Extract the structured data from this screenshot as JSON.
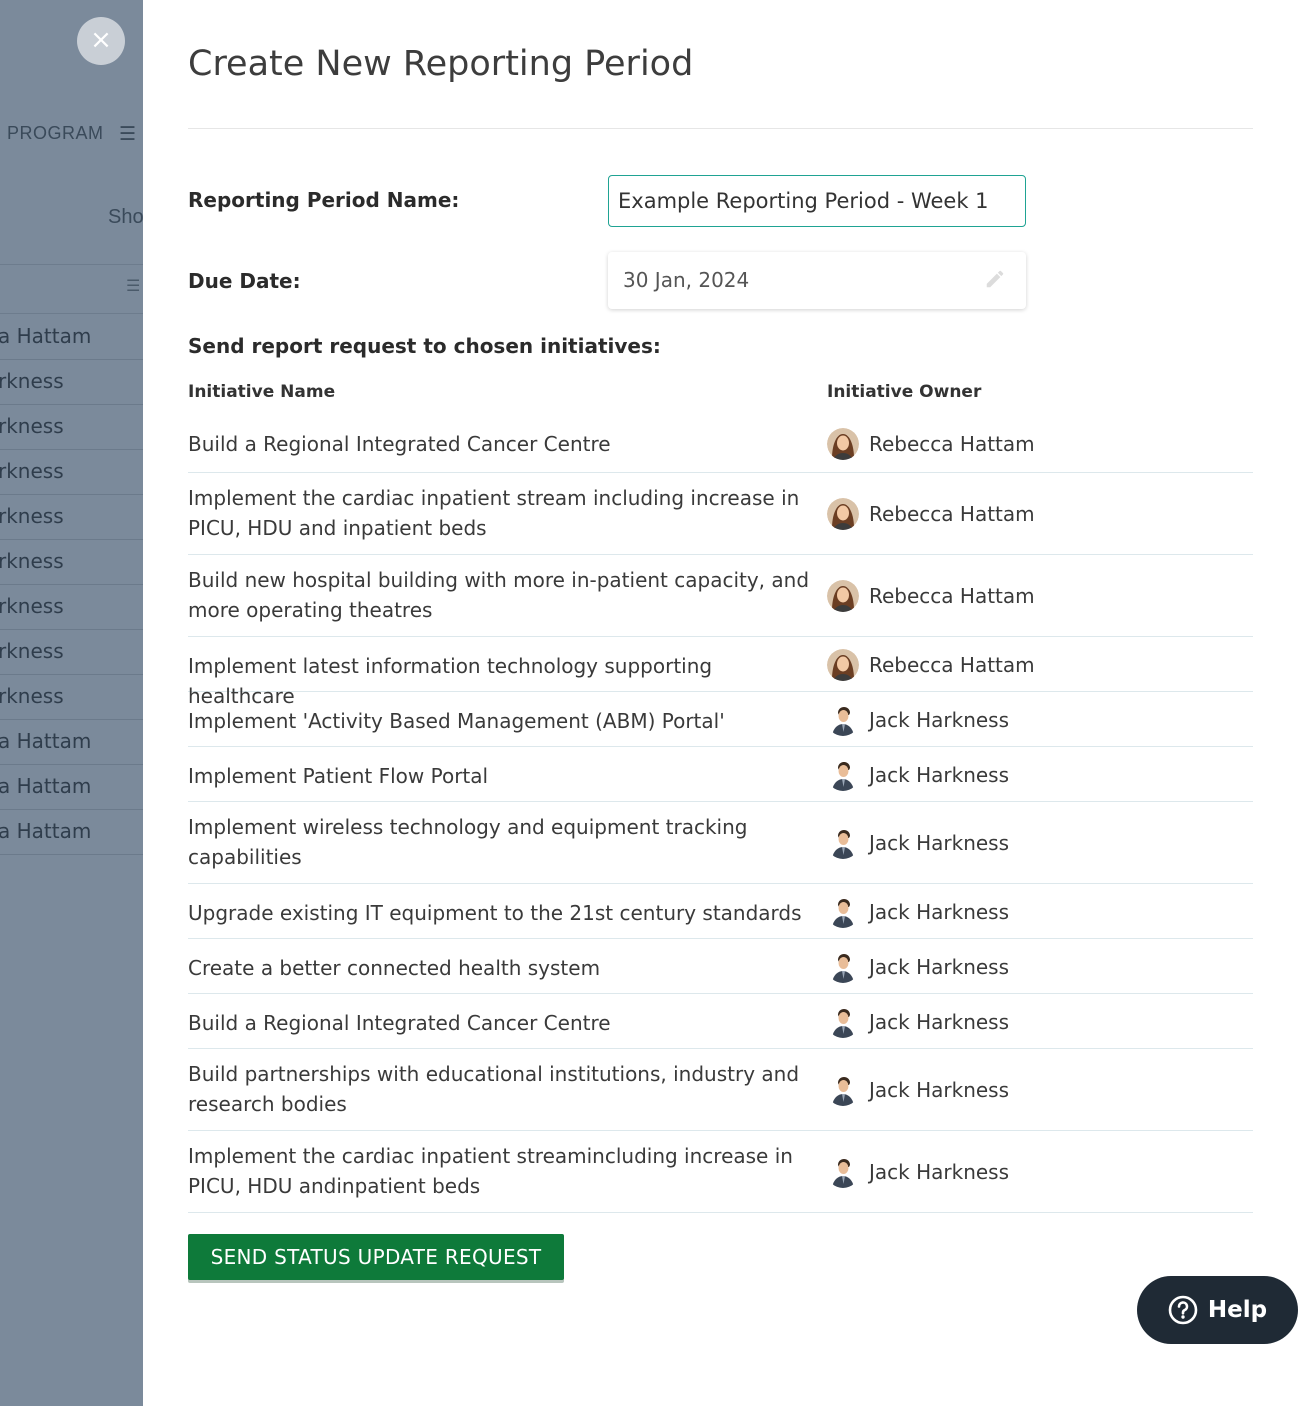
{
  "background": {
    "program_label": "PROGRAM",
    "menu_icon": "☰",
    "partial_text": "Sho",
    "list_icon": "☰",
    "rows": [
      "a Hattam",
      "rkness",
      "rkness",
      "rkness",
      "rkness",
      "rkness",
      "rkness",
      "rkness",
      "rkness",
      "a Hattam",
      "a Hattam",
      "a Hattam"
    ]
  },
  "close_icon": "×",
  "modal": {
    "title": "Create New Reporting Period",
    "name_label": "Reporting Period Name:",
    "name_value": "Example Reporting Period - Week 1",
    "due_label": "Due Date:",
    "due_value": "30 Jan, 2024",
    "send_label": "Send report request to chosen initiatives:",
    "col_name": "Initiative Name",
    "col_owner": "Initiative Owner",
    "initiatives": [
      {
        "name": "Build a Regional Integrated Cancer Centre",
        "owner": "Rebecca Hattam",
        "avatar": "female"
      },
      {
        "name": "Implement the cardiac inpatient stream including increase in PICU, HDU and inpatient beds",
        "owner": "Rebecca Hattam",
        "avatar": "female"
      },
      {
        "name": "Build new hospital building with more in-patient capacity, and more operating theatres",
        "owner": "Rebecca Hattam",
        "avatar": "female"
      },
      {
        "name": "Implement latest information technology supporting healthcare",
        "owner": "Rebecca Hattam",
        "avatar": "female"
      },
      {
        "name": "Implement 'Activity Based Management (ABM) Portal'",
        "owner": "Jack Harkness",
        "avatar": "male"
      },
      {
        "name": "Implement Patient Flow Portal",
        "owner": "Jack Harkness",
        "avatar": "male"
      },
      {
        "name": "Implement wireless technology and equipment tracking capabilities",
        "owner": "Jack Harkness",
        "avatar": "male"
      },
      {
        "name": "Upgrade existing IT equipment to the 21st century standards",
        "owner": "Jack Harkness",
        "avatar": "male"
      },
      {
        "name": "Create a better connected health system",
        "owner": "Jack Harkness",
        "avatar": "male"
      },
      {
        "name": "Build a Regional Integrated Cancer Centre",
        "owner": "Jack Harkness",
        "avatar": "male"
      },
      {
        "name": "Build partnerships with educational institutions, industry and research bodies",
        "owner": "Jack Harkness",
        "avatar": "male"
      },
      {
        "name": "Implement the cardiac inpatient streamincluding increase in PICU, HDU andinpatient beds",
        "owner": "Jack Harkness",
        "avatar": "male"
      }
    ],
    "submit_label": "SEND STATUS UPDATE REQUEST"
  },
  "help": {
    "label": "Help",
    "icon": "question-circle-icon"
  },
  "colors": {
    "accent": "#1fa393",
    "submit": "#0e7a3a",
    "help_bg": "#1f2a35"
  }
}
